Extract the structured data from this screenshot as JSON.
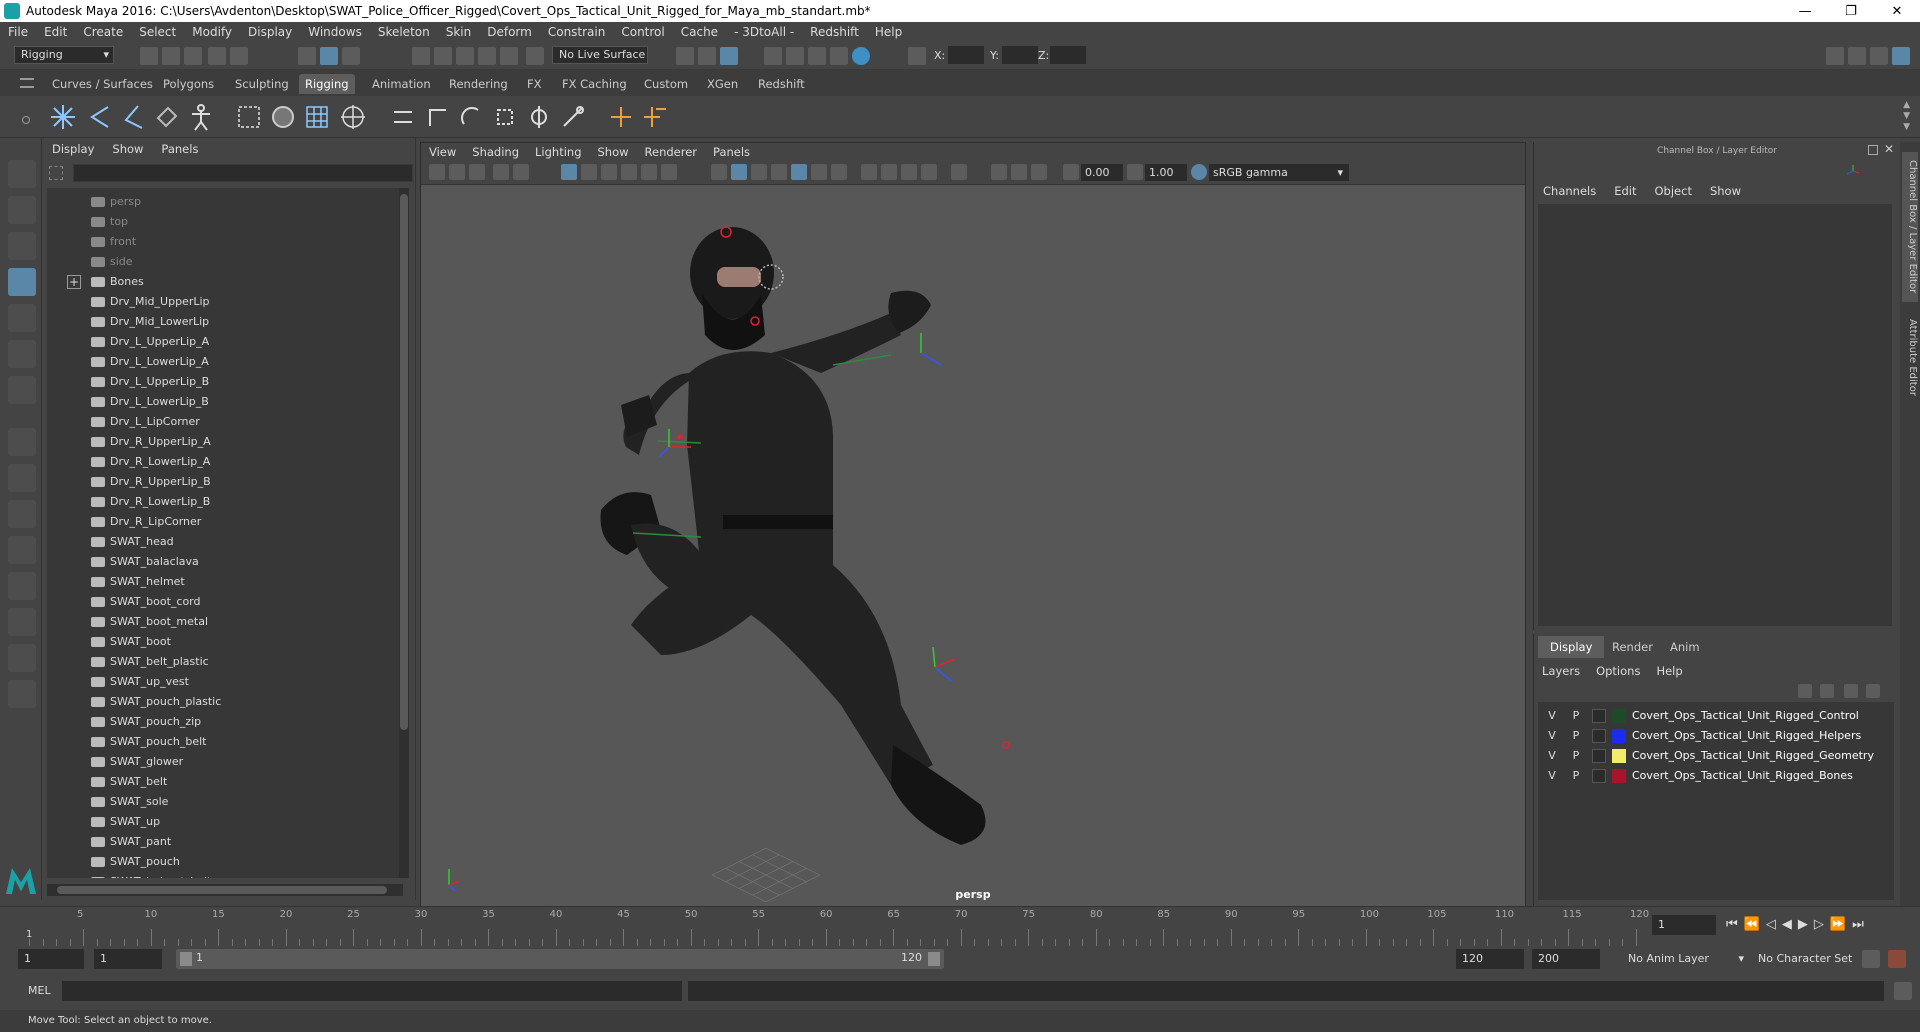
{
  "title_bar": {
    "title": "Autodesk Maya 2016: C:\\Users\\Avdenton\\Desktop\\SWAT_Police_Officer_Rigged\\Covert_Ops_Tactical_Unit_Rigged_for_Maya_mb_standart.mb*",
    "minimize": "—",
    "maximize": "❐",
    "close": "✕"
  },
  "menu": [
    "File",
    "Edit",
    "Create",
    "Select",
    "Modify",
    "Display",
    "Windows",
    "Skeleton",
    "Skin",
    "Deform",
    "Constrain",
    "Control",
    "Cache",
    "- 3DtoAll -",
    "Redshift",
    "Help"
  ],
  "status_line": {
    "mode": "Rigging",
    "live_surface": "No Live Surface",
    "x_label": "X:",
    "y_label": "Y:",
    "z_label": "Z:"
  },
  "shelf_tabs": [
    "Curves / Surfaces",
    "Polygons",
    "Sculpting",
    "Rigging",
    "Animation",
    "Rendering",
    "FX",
    "FX Caching",
    "Custom",
    "XGen",
    "Redshift"
  ],
  "active_shelf_tab": "Rigging",
  "outliner": {
    "menu": [
      "Display",
      "Show",
      "Panels"
    ],
    "items": [
      {
        "label": "persp",
        "dim": true
      },
      {
        "label": "top",
        "dim": true
      },
      {
        "label": "front",
        "dim": true
      },
      {
        "label": "side",
        "dim": true
      },
      {
        "label": "Bones",
        "dim": false,
        "group": true
      },
      {
        "label": "Drv_Mid_UpperLip",
        "dim": false
      },
      {
        "label": "Drv_Mid_LowerLip",
        "dim": false
      },
      {
        "label": "Drv_L_UpperLip_A",
        "dim": false
      },
      {
        "label": "Drv_L_LowerLip_A",
        "dim": false
      },
      {
        "label": "Drv_L_UpperLip_B",
        "dim": false
      },
      {
        "label": "Drv_L_LowerLip_B",
        "dim": false
      },
      {
        "label": "Drv_L_LipCorner",
        "dim": false
      },
      {
        "label": "Drv_R_UpperLip_A",
        "dim": false
      },
      {
        "label": "Drv_R_LowerLip_A",
        "dim": false
      },
      {
        "label": "Drv_R_UpperLip_B",
        "dim": false
      },
      {
        "label": "Drv_R_LowerLip_B",
        "dim": false
      },
      {
        "label": "Drv_R_LipCorner",
        "dim": false
      },
      {
        "label": "SWAT_head",
        "dim": false
      },
      {
        "label": "SWAT_balaclava",
        "dim": false
      },
      {
        "label": "SWAT_helmet",
        "dim": false
      },
      {
        "label": "SWAT_boot_cord",
        "dim": false
      },
      {
        "label": "SWAT_boot_metal",
        "dim": false
      },
      {
        "label": "SWAT_boot",
        "dim": false
      },
      {
        "label": "SWAT_belt_plastic",
        "dim": false
      },
      {
        "label": "SWAT_up_vest",
        "dim": false
      },
      {
        "label": "SWAT_pouch_plastic",
        "dim": false
      },
      {
        "label": "SWAT_pouch_zip",
        "dim": false
      },
      {
        "label": "SWAT_pouch_belt",
        "dim": false
      },
      {
        "label": "SWAT_glower",
        "dim": false
      },
      {
        "label": "SWAT_belt",
        "dim": false
      },
      {
        "label": "SWAT_sole",
        "dim": false
      },
      {
        "label": "SWAT_up",
        "dim": false
      },
      {
        "label": "SWAT_pant",
        "dim": false
      },
      {
        "label": "SWAT_pouch",
        "dim": false
      },
      {
        "label": "SWAT_helmet_belt",
        "dim": false
      }
    ]
  },
  "viewport": {
    "menu": [
      "View",
      "Shading",
      "Lighting",
      "Show",
      "Renderer",
      "Panels"
    ],
    "field_a": "0.00",
    "field_b": "1.00",
    "color_space": "sRGB gamma",
    "camera_label": "persp"
  },
  "channel_box": {
    "title": "Channel Box / Layer Editor",
    "menu": [
      "Channels",
      "Edit",
      "Object",
      "Show"
    ]
  },
  "side_tabs": [
    "Channel Box / Layer Editor",
    "Attribute Editor"
  ],
  "layer_editor": {
    "tabs": [
      "Display",
      "Render",
      "Anim"
    ],
    "active_tab": "Display",
    "menu": [
      "Layers",
      "Options",
      "Help"
    ],
    "layers": [
      {
        "v": "V",
        "p": "P",
        "color": "#1f4a2a",
        "name": "Covert_Ops_Tactical_Unit_Rigged_Control"
      },
      {
        "v": "V",
        "p": "P",
        "color": "#1a2cf0",
        "name": "Covert_Ops_Tactical_Unit_Rigged_Helpers"
      },
      {
        "v": "V",
        "p": "P",
        "color": "#f2ee6a",
        "name": "Covert_Ops_Tactical_Unit_Rigged_Geometry"
      },
      {
        "v": "V",
        "p": "P",
        "color": "#a8142c",
        "name": "Covert_Ops_Tactical_Unit_Rigged_Bones"
      }
    ]
  },
  "timeline": {
    "ticks": [
      "5",
      "10",
      "15",
      "20",
      "25",
      "30",
      "35",
      "40",
      "45",
      "50",
      "55",
      "60",
      "65",
      "70",
      "75",
      "80",
      "85",
      "90",
      "95",
      "100",
      "105",
      "110",
      "115",
      "120"
    ],
    "start_marker": "1",
    "current_frame": "1"
  },
  "range": {
    "start": "1",
    "playback_start": "1",
    "range_start_label": "1",
    "range_end_label": "120",
    "playback_end": "120",
    "end": "200",
    "anim_layer": "No Anim Layer",
    "character_set": "No Character Set"
  },
  "command_line": {
    "label": "MEL"
  },
  "help_line": "Move Tool: Select an object to move."
}
